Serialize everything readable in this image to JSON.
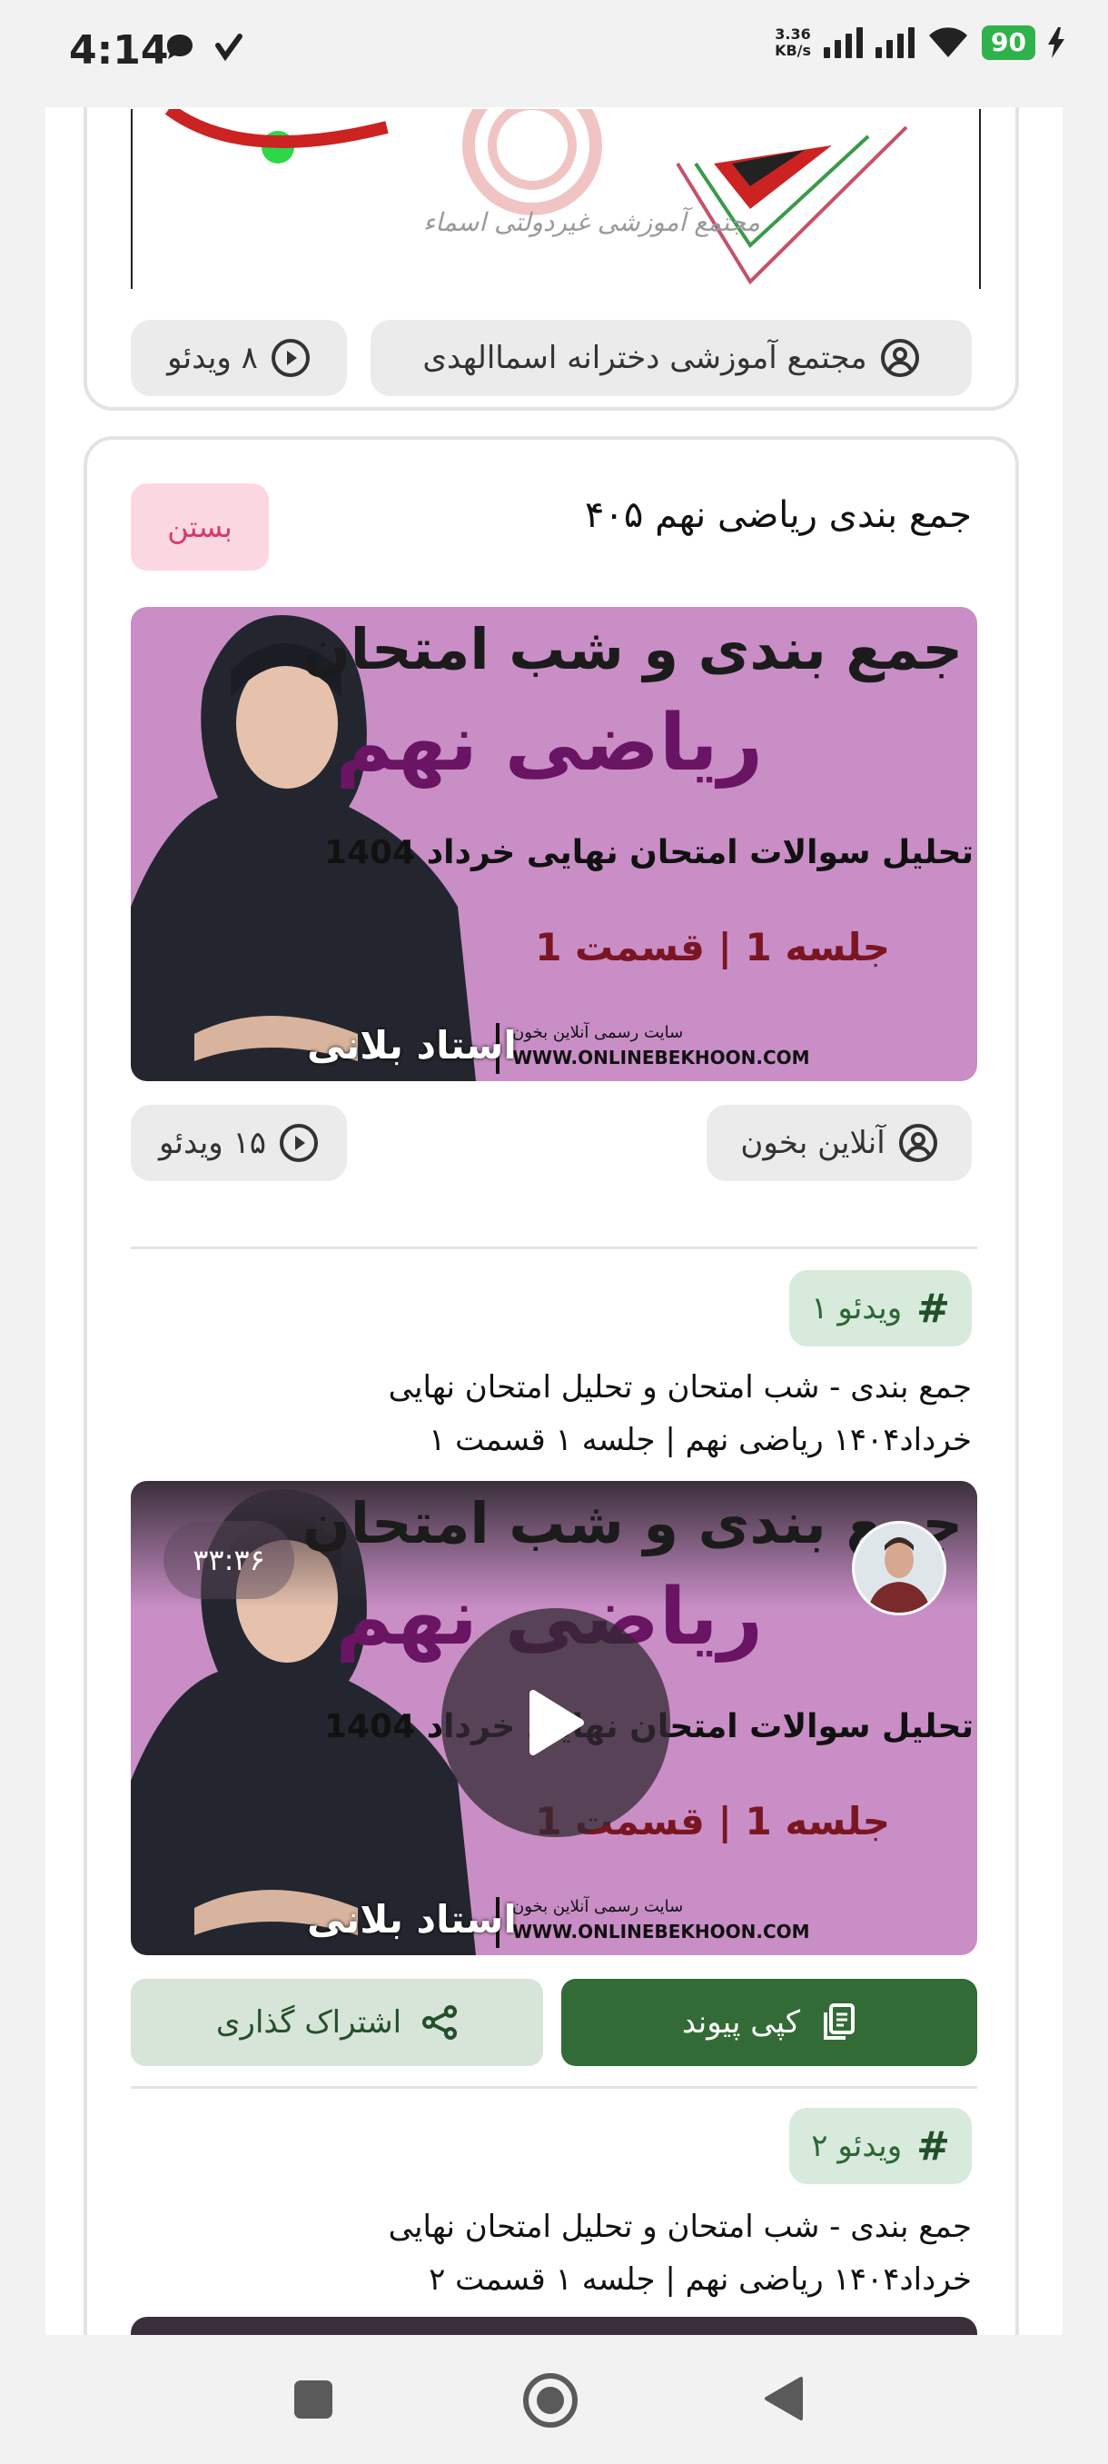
{
  "status_bar": {
    "time": "4:14",
    "net_speed": "3.36",
    "net_unit": "KB/s",
    "battery": "90"
  },
  "card1": {
    "logo_text": "مجتمع آموزشی غیردولتی اسماء",
    "owner": "مجتمع آموزشی دخترانه اسماالهدی",
    "video_count": "۸ ویدئو"
  },
  "course": {
    "title": "جمع بندی ریاضی نهم ۴۰۵",
    "close_label": "بستن",
    "owner": "آنلاین بخون",
    "video_count": "۱۵ ویدئو"
  },
  "banner": {
    "heading": "جمع بندی و شب امتحان",
    "subject": "ریاضی نهم",
    "subtitle": "تحلیل سوالات امتحان نهایی خرداد 1404",
    "session": "جلسه 1 | قسمت 1",
    "site_fa": "سایت رسمی آنلاین بخون",
    "site": "WWW.ONLINEBEKHOON.COM",
    "teacher": "استاد بلانی"
  },
  "videos": [
    {
      "tag": "ویدئو ۱",
      "title_line1": "جمع بندی - شب امتحان و تحلیل امتحان نهایی",
      "title_line2": "خرداد۱۴۰۴ ریاضی نهم | جلسه ۱ قسمت ۱",
      "duration": "۳۳:۳۶"
    },
    {
      "tag": "ویدئو ۲",
      "title_line1": "جمع بندی - شب امتحان و تحلیل امتحان نهایی",
      "title_line2": "خرداد۱۴۰۴ ریاضی نهم | جلسه ۱ قسمت ۲"
    }
  ],
  "actions": {
    "copy_link": "کپی پیوند",
    "share": "اشتراک گذاری"
  },
  "colors": {
    "primary_green": "#336b36",
    "light_green": "#d7e4d8",
    "close_pink": "#fbd7e2",
    "close_text": "#d53a6b",
    "banner_purple": "#c98ec6"
  }
}
